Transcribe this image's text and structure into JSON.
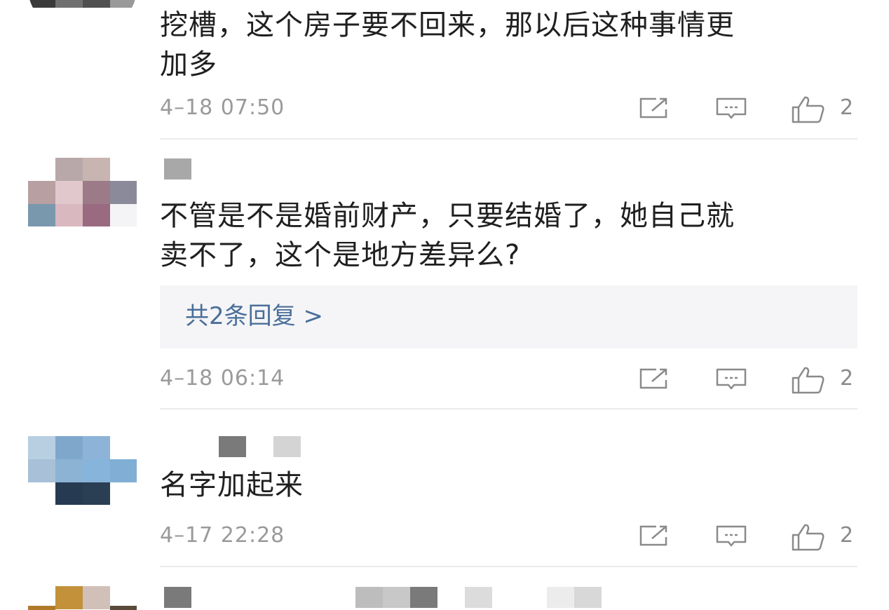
{
  "comments": [
    {
      "text_line1": "挖槽，这个房子要不回来，那以后这种事情更",
      "text_line2": "加多",
      "time": "4–18 07:50",
      "likes": "2"
    },
    {
      "text_line1": "不管是不是婚前财产，只要结婚了，她自己就",
      "text_line2": "卖不了，这个是地方差异么?",
      "reply_label": "共2条回复 >",
      "time": "4–18 06:14",
      "likes": "2"
    },
    {
      "text_line1": "名字加起来",
      "time": "4–17 22:28",
      "likes": "2"
    }
  ],
  "icons": {
    "share": "share-icon",
    "comment": "comment-icon",
    "like": "thumbs-up-icon"
  },
  "colors": {
    "reply_link": "#4a6f9a",
    "meta_text": "#9a9a9a",
    "icon_stroke": "#8a8a8a",
    "divider": "#ebebeb",
    "reply_bg": "#f5f5f7"
  }
}
